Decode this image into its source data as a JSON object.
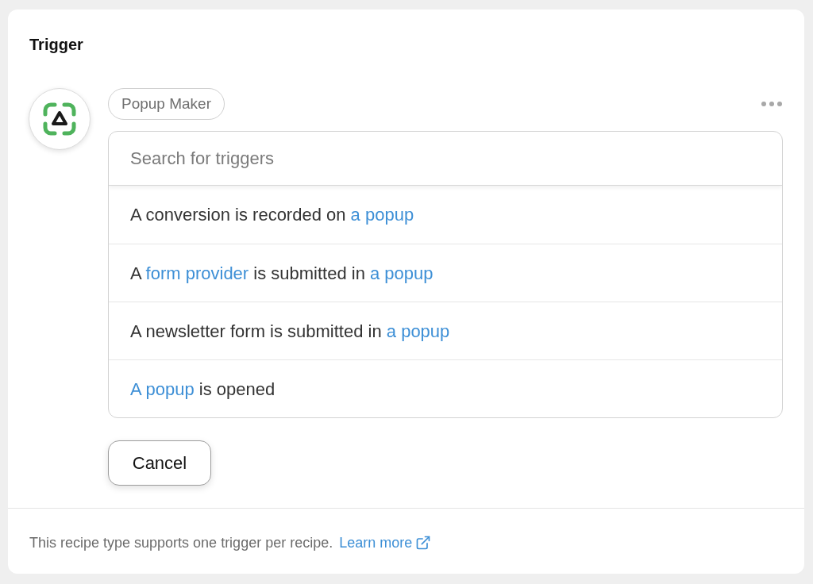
{
  "panel": {
    "title": "Trigger"
  },
  "integration": {
    "name": "Popup Maker"
  },
  "trigger_picker": {
    "search": {
      "placeholder": "Search for triggers"
    },
    "options": [
      {
        "parts": [
          {
            "kind": "text",
            "text": "A conversion is recorded on "
          },
          {
            "kind": "token",
            "text": "a popup"
          }
        ]
      },
      {
        "parts": [
          {
            "kind": "text",
            "text": "A "
          },
          {
            "kind": "token",
            "text": "form provider"
          },
          {
            "kind": "text",
            "text": " is submitted in "
          },
          {
            "kind": "token",
            "text": "a popup"
          }
        ]
      },
      {
        "parts": [
          {
            "kind": "text",
            "text": "A newsletter form is submitted in "
          },
          {
            "kind": "token",
            "text": "a popup"
          }
        ]
      },
      {
        "parts": [
          {
            "kind": "token",
            "text": "A popup"
          },
          {
            "kind": "text",
            "text": " is opened"
          }
        ]
      }
    ]
  },
  "buttons": [
    {
      "label": "Cancel"
    }
  ],
  "footer": {
    "note": "This recipe type supports one trigger per recipe.",
    "link": "Learn more"
  }
}
